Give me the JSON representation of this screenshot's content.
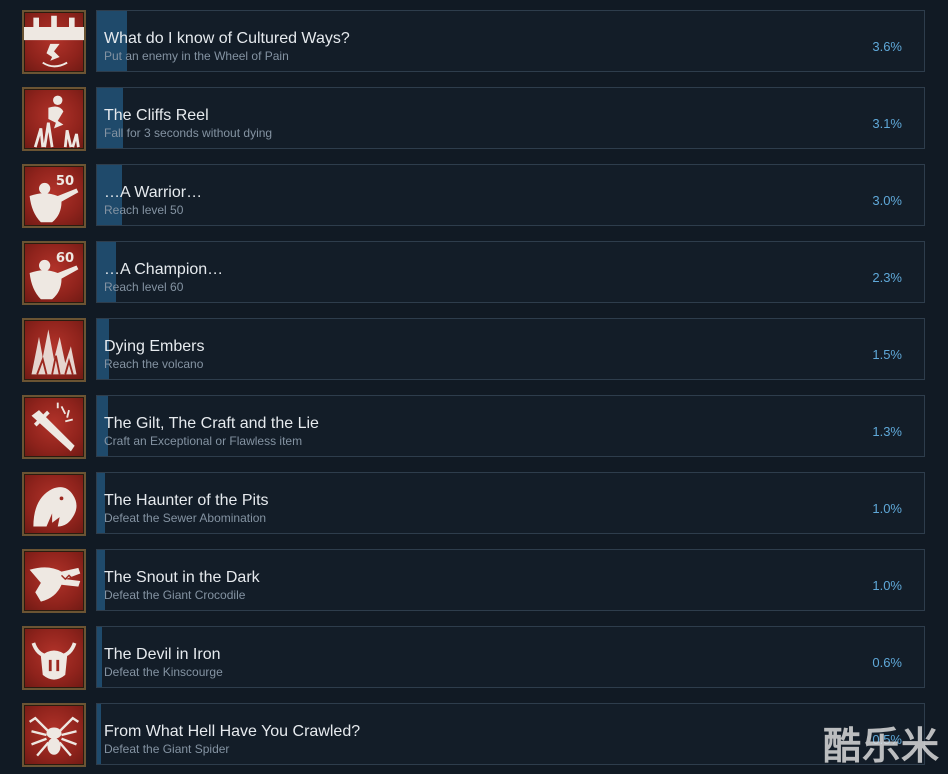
{
  "achievements": [
    {
      "title": "What do I know of Cultured Ways?",
      "description": "Put an enemy in the Wheel of Pain",
      "percent": "3.6%",
      "progress": 3.6,
      "icon": "wheel-of-pain-icon"
    },
    {
      "title": "The Cliffs Reel",
      "description": "Fall for 3 seconds without dying",
      "percent": "3.1%",
      "progress": 3.1,
      "icon": "falling-figure-icon"
    },
    {
      "title": "…A Warrior…",
      "description": "Reach level 50",
      "percent": "3.0%",
      "progress": 3.0,
      "icon": "warrior-level-50-icon",
      "badge": "50"
    },
    {
      "title": "…A Champion…",
      "description": "Reach level 60",
      "percent": "2.3%",
      "progress": 2.3,
      "icon": "champion-level-60-icon",
      "badge": "60"
    },
    {
      "title": "Dying Embers",
      "description": "Reach the volcano",
      "percent": "1.5%",
      "progress": 1.5,
      "icon": "volcano-icon"
    },
    {
      "title": "The Gilt, The Craft and the Lie",
      "description": "Craft an Exceptional or Flawless item",
      "percent": "1.3%",
      "progress": 1.3,
      "icon": "crafted-sword-icon"
    },
    {
      "title": "The Haunter of the Pits",
      "description": "Defeat the Sewer Abomination",
      "percent": "1.0%",
      "progress": 1.0,
      "icon": "sewer-abomination-icon"
    },
    {
      "title": "The Snout in the Dark",
      "description": "Defeat the Giant Crocodile",
      "percent": "1.0%",
      "progress": 1.0,
      "icon": "crocodile-icon"
    },
    {
      "title": "The Devil in Iron",
      "description": "Defeat the Kinscourge",
      "percent": "0.6%",
      "progress": 0.6,
      "icon": "horned-helmet-icon"
    },
    {
      "title": "From What Hell Have You Crawled?",
      "description": "Defeat the Giant Spider",
      "percent": "0.5%",
      "progress": 0.5,
      "icon": "spider-icon"
    }
  ],
  "watermark": "酷乐米",
  "colors": {
    "background": "#111a24",
    "card": "#131d28",
    "card_border": "#2e3d4c",
    "progress_fill": "#1f4a6b",
    "percent_text": "#5fa8d8",
    "icon_red": "#9c281f",
    "icon_frame": "#6b5433"
  }
}
